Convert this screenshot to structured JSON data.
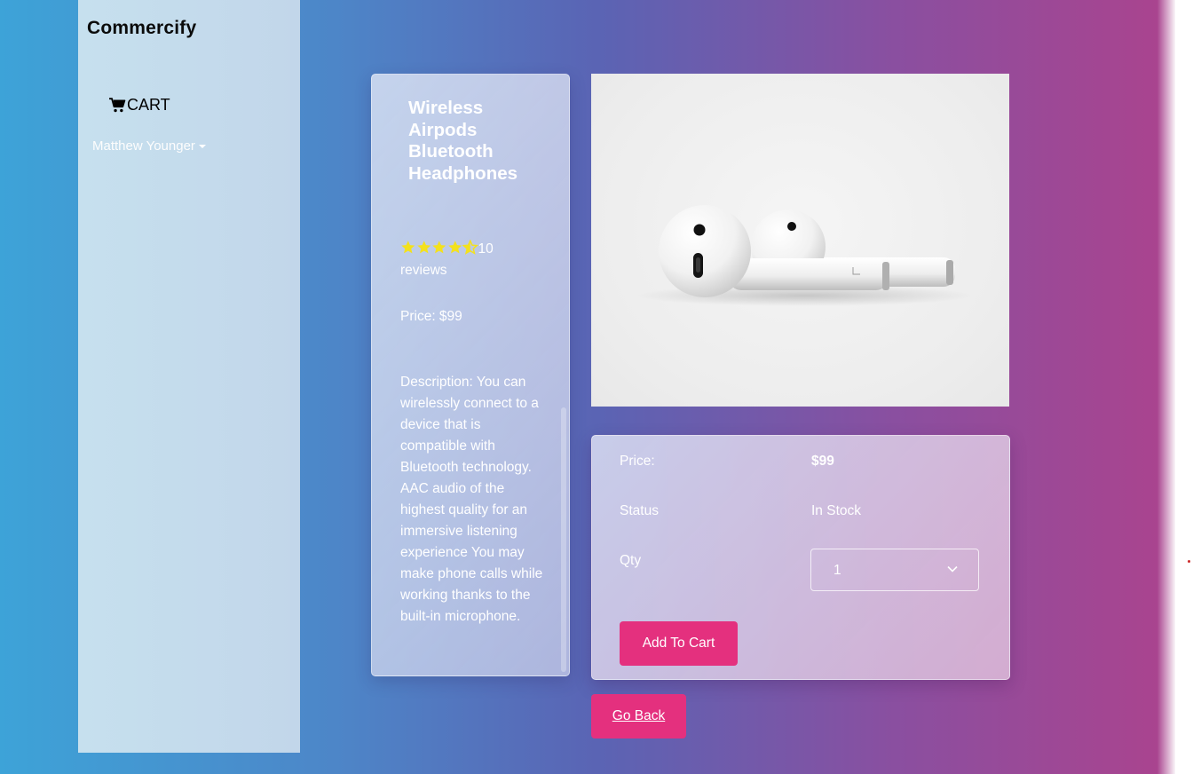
{
  "brand": {
    "name": "Commercify"
  },
  "nav": {
    "cart_label": "CART",
    "cart_icon": "cart-icon",
    "user_name": "Matthew Younger",
    "user_caret_icon": "caret-down-icon"
  },
  "product": {
    "title": "Wireless Airpods Bluetooth Headphones",
    "rating": 4.5,
    "rating_max": 5,
    "star_color": "#f3e11d",
    "reviews_text": "10 reviews",
    "price_line": "Price: $99",
    "description": "Description: You can wirelessly connect to a device that is compatible with Bluetooth technology. AAC audio of the highest quality for an immersive listening experience You may make phone calls while working thanks to the built-in microphone.",
    "image_subject": "white wireless earbuds"
  },
  "purchase": {
    "price_label": "Price:",
    "price_value": "$99",
    "status_label": "Status",
    "status_value": "In Stock",
    "qty_label": "Qty",
    "qty_selected": "1",
    "add_button": "Add To Cart"
  },
  "actions": {
    "back_button": "Go Back"
  },
  "colors": {
    "accent_button": "#e4307e",
    "gradient_start": "#3da3d8",
    "gradient_end": "#a9448f"
  }
}
